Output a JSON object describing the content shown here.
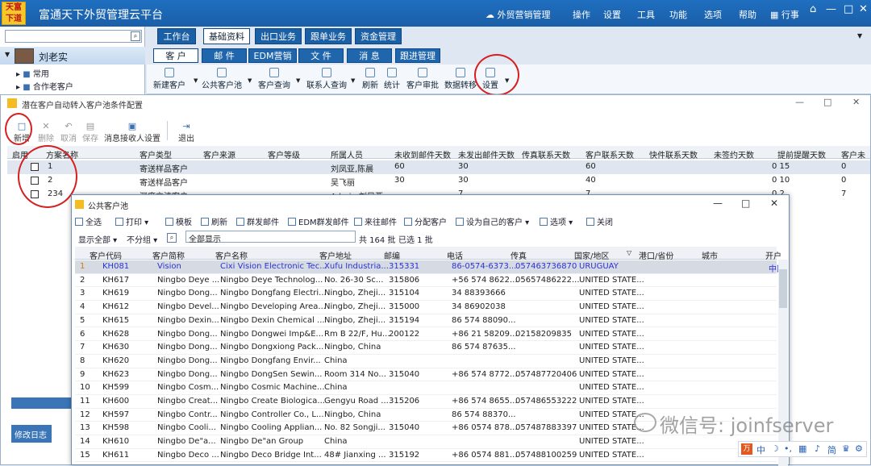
{
  "app": {
    "logo_text": "天富下道",
    "title": "富通天下外贸管理云平台"
  },
  "topmenu": {
    "marketing": "外贸营销管理",
    "items": [
      "操作",
      "设置",
      "工具",
      "功能",
      "选项",
      "帮助",
      "行事"
    ]
  },
  "left": {
    "user": "刘老实",
    "tree": [
      "常用",
      "合作老客户"
    ],
    "log": "修改日志"
  },
  "tabs_main": [
    "工作台",
    "基础资料",
    "出口业务",
    "跟单业务",
    "资金管理"
  ],
  "tabs_sub": [
    "客 户",
    "邮 件",
    "EDM营销",
    "文 件",
    "消 息",
    "跟进管理"
  ],
  "ribbon": [
    "新建客户",
    "公共客户池",
    "客户查询",
    "联系人查询",
    "刷新",
    "统计",
    "客户审批",
    "数据转移",
    "设置"
  ],
  "dialog1": {
    "title": "潜在客户自动转入客户池条件配置",
    "toolbar": [
      "新增",
      "删除",
      "取消",
      "保存",
      "消息接收人设置",
      "退出"
    ],
    "headers": [
      "启用",
      "方案名称",
      "客户类型",
      "客户来源",
      "客户等级",
      "所属人员",
      "未收到邮件天数",
      "未发出邮件天数",
      "传真联系天数",
      "客户联系天数",
      "快件联系天数",
      "未签约天数",
      "提前提醒天数",
      "客户未"
    ],
    "rows": [
      {
        "name": "1",
        "type": "寄送样品客户",
        "owner": "刘凤亚,陈晨",
        "nrecv": "60",
        "nsent": "30",
        "cust": "60",
        "remind": "0 15",
        "last": "0"
      },
      {
        "name": "2",
        "type": "寄送样品客户",
        "owner": "吴飞丽",
        "nrecv": "30",
        "nsent": "30",
        "cust": "40",
        "remind": "0 10",
        "last": "0"
      },
      {
        "name": "234",
        "type": "深度交流客户",
        "owner": "Admin,刘凤亚...",
        "nrecv": "",
        "nsent": "7",
        "cust": "7",
        "remind": "0 2",
        "last": "7"
      }
    ]
  },
  "dialog2": {
    "title": "公共客户池",
    "toolbar": [
      "全选",
      "打印",
      "模板",
      "刷新",
      "群发邮件",
      "EDM群发邮件",
      "来往邮件",
      "分配客户",
      "设为自己的客户",
      "选项",
      "关闭"
    ],
    "filter": {
      "show": "显示全部",
      "group": "不分组",
      "input": "全部显示",
      "count": "共 164 批",
      "selected": "已选 1 批"
    },
    "headers": [
      "客户代码",
      "客户简称",
      "客户名称",
      "客户地址",
      "邮编",
      "电话",
      "传真",
      "国家/地区",
      "港口/省份",
      "城市",
      "开户"
    ],
    "rows": [
      {
        "n": "1",
        "code": "KH081",
        "short": "Vision",
        "name": "Cixi Vision Electronic Tec...",
        "addr": "Xufu Industria...",
        "zip": "315331",
        "tel": "86-0574-6373...",
        "fax": "057463736870",
        "country": "URUGUAY",
        "last": "中国"
      },
      {
        "n": "2",
        "code": "KH617",
        "short": "Ningbo Deye ...",
        "name": "Ningbo Deye Technolog...",
        "addr": "No. 26-30 Sc...",
        "zip": "315806",
        "tel": "+56 574 8622...",
        "fax": "05657486222...",
        "country": "UNITED STATE...",
        "last": ""
      },
      {
        "n": "3",
        "code": "KH619",
        "short": "Ningbo Dong...",
        "name": "Ningbo Dongfang Electri...",
        "addr": "Ningbo, Zheji...",
        "zip": "315104",
        "tel": "34 88393666",
        "fax": "",
        "country": "UNITED STATE...",
        "last": ""
      },
      {
        "n": "4",
        "code": "KH612",
        "short": "Ningbo Devel...",
        "name": "Ningbo Developing Area...",
        "addr": "Ningbo, Zheji...",
        "zip": "315000",
        "tel": "34 86902038",
        "fax": "",
        "country": "UNITED STATE...",
        "last": ""
      },
      {
        "n": "5",
        "code": "KH615",
        "short": "Ningbo Dexin...",
        "name": "Ningbo Dexin Chemical ...",
        "addr": "Ningbo, Zheji...",
        "zip": "315194",
        "tel": "86 574 88090...",
        "fax": "",
        "country": "UNITED STATE...",
        "last": ""
      },
      {
        "n": "6",
        "code": "KH628",
        "short": "Ningbo Dong...",
        "name": "Ningbo Dongwei Imp&E...",
        "addr": "Rm B 22/F, Hu...",
        "zip": "200122",
        "tel": "+86 21 58209...",
        "fax": "02158209835",
        "country": "UNITED STATE...",
        "last": ""
      },
      {
        "n": "7",
        "code": "KH630",
        "short": "Ningbo Dong...",
        "name": "Ningbo Dongxiong Pack...",
        "addr": "Ningbo, China",
        "zip": "",
        "tel": "86 574 87635...",
        "fax": "",
        "country": "UNITED STATE...",
        "last": ""
      },
      {
        "n": "8",
        "code": "KH620",
        "short": "Ningbo Dong...",
        "name": "Ningbo Dongfang Envir...",
        "addr": "China",
        "zip": "",
        "tel": "",
        "fax": "",
        "country": "UNITED STATE...",
        "last": ""
      },
      {
        "n": "9",
        "code": "KH623",
        "short": "Ningbo Dong...",
        "name": "Ningbo DongSen Sewin...",
        "addr": "Room 314 No...",
        "zip": "315040",
        "tel": "+86 574 8772...",
        "fax": "057487720406",
        "country": "UNITED STATE...",
        "last": ""
      },
      {
        "n": "10",
        "code": "KH599",
        "short": "Ningbo Cosm...",
        "name": "Ningbo Cosmic Machine...",
        "addr": "China",
        "zip": "",
        "tel": "",
        "fax": "",
        "country": "UNITED STATE...",
        "last": ""
      },
      {
        "n": "11",
        "code": "KH600",
        "short": "Ningbo Creat...",
        "name": "Ningbo Create Biologica...",
        "addr": "Gengyu Road ...",
        "zip": "315206",
        "tel": "+86 574 8655...",
        "fax": "057486553222",
        "country": "UNITED STATE...",
        "last": ""
      },
      {
        "n": "12",
        "code": "KH597",
        "short": "Ningbo Contr...",
        "name": "Ningbo Controller Co., L...",
        "addr": "Ningbo, China",
        "zip": "",
        "tel": "86 574 88370...",
        "fax": "",
        "country": "UNITED STATE...",
        "last": ""
      },
      {
        "n": "13",
        "code": "KH598",
        "short": "Ningbo Cooli...",
        "name": "Ningbo Cooling Applian...",
        "addr": "No. 82 Songji...",
        "zip": "315040",
        "tel": "+86 0574 878...",
        "fax": "057487883397",
        "country": "UNITED STATE...",
        "last": ""
      },
      {
        "n": "14",
        "code": "KH610",
        "short": "Ningbo De\"a...",
        "name": "Ningbo De\"an Group",
        "addr": "China",
        "zip": "",
        "tel": "",
        "fax": "",
        "country": "UNITED STATE...",
        "last": ""
      },
      {
        "n": "15",
        "code": "KH611",
        "short": "Ningbo Deco ...",
        "name": "Ningbo Deco Bridge Int...",
        "addr": "48# Jianxing ...",
        "zip": "315192",
        "tel": "+86 0574 881...",
        "fax": "057488100259",
        "country": "UNITED STATE...",
        "last": ""
      }
    ]
  },
  "watermark": "微信号: joinfserver",
  "ime": {
    "lang": "中",
    "mode": "简"
  }
}
